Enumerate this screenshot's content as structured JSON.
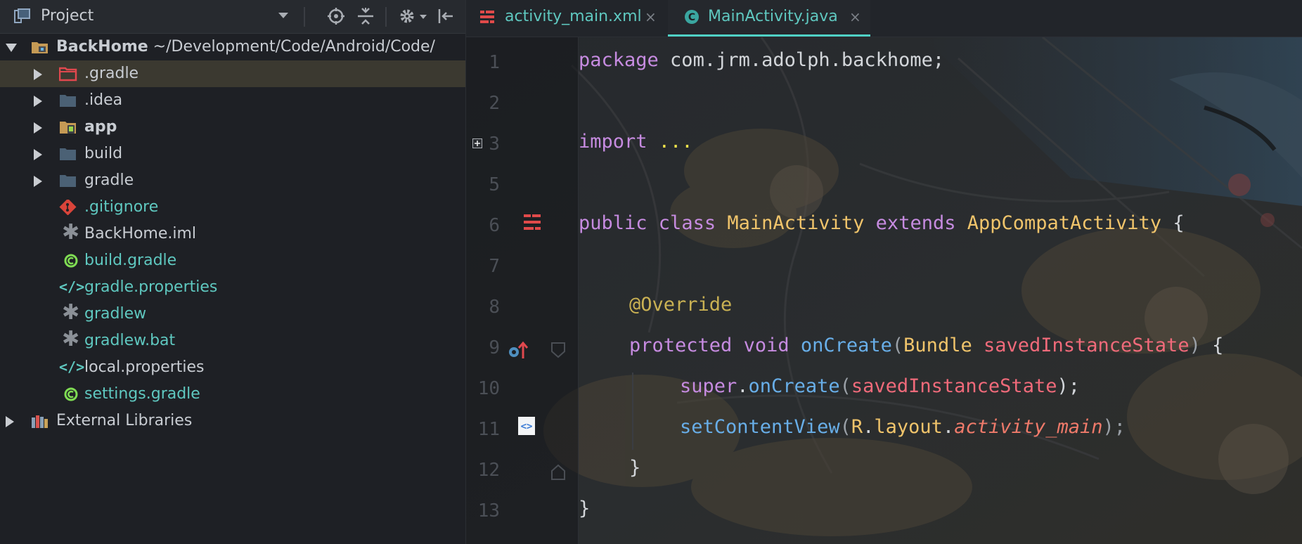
{
  "project_panel": {
    "title": "Project",
    "tree": [
      {
        "name": "BackHome",
        "path": " ~/Development/Code/Android/Code/",
        "level": 0,
        "expanded": true,
        "kind": "module-folder-icon"
      },
      {
        "name": ".gradle",
        "level": 1,
        "expandable": true,
        "kind": "excluded-folder-icon",
        "selected": true
      },
      {
        "name": ".idea",
        "level": 1,
        "expandable": true,
        "kind": "folder-icon"
      },
      {
        "name": "app",
        "level": 1,
        "expandable": true,
        "kind": "android-module-icon",
        "bold": true
      },
      {
        "name": "build",
        "level": 1,
        "expandable": true,
        "kind": "folder-icon"
      },
      {
        "name": "gradle",
        "level": 1,
        "expandable": true,
        "kind": "folder-icon"
      },
      {
        "name": ".gitignore",
        "level": 1,
        "kind": "git-icon",
        "teal": true
      },
      {
        "name": "BackHome.iml",
        "level": 1,
        "kind": "asterisk-icon"
      },
      {
        "name": "build.gradle",
        "level": 1,
        "kind": "gradle-icon",
        "teal": true
      },
      {
        "name": "gradle.properties",
        "level": 1,
        "kind": "properties-icon",
        "teal": true
      },
      {
        "name": "gradlew",
        "level": 1,
        "kind": "asterisk-icon",
        "teal": true
      },
      {
        "name": "gradlew.bat",
        "level": 1,
        "kind": "asterisk-icon",
        "teal": true
      },
      {
        "name": "local.properties",
        "level": 1,
        "kind": "properties-icon"
      },
      {
        "name": "settings.gradle",
        "level": 1,
        "kind": "gradle-icon",
        "teal": true
      },
      {
        "name": "External Libraries",
        "level": 0,
        "expandable": true,
        "kind": "libraries-icon"
      }
    ]
  },
  "editor": {
    "tabs": [
      {
        "label": "activity_main.xml",
        "close": "×",
        "icon": "layout-xml-icon",
        "active": false
      },
      {
        "label": "MainActivity.java",
        "close": "×",
        "icon": "java-class-icon",
        "active": true
      }
    ],
    "line_numbers": [
      "1",
      "2",
      "3",
      "5",
      "6",
      "7",
      "8",
      "9",
      "10",
      "11",
      "12",
      "13"
    ],
    "code": {
      "l1_kw": "package",
      "l1_rest": " com.jrm.adolph.backhome;",
      "l3_kw": "import",
      "l3_dots": " ...",
      "l6_kw1": "public",
      "l6_kw2": " class",
      "l6_cls": " MainActivity",
      "l6_kw3": " extends",
      "l6_cls2": " AppCompatActivity",
      "l6_brace": " {",
      "l8_ann": "@Override",
      "l9_kw1": "protected",
      "l9_kw2": " void",
      "l9_fn": " onCreate",
      "l9_p1": "(",
      "l9_cls": "Bundle",
      "l9_param": " savedInstanceState",
      "l9_p2": ")",
      "l9_brace": " {",
      "l10_kw": "super",
      "l10_dot": ".",
      "l10_fn": "onCreate",
      "l10_p1": "(",
      "l10_param": "savedInstanceState",
      "l10_p2": ");",
      "l11_fn": "setContentView",
      "l11_p1": "(",
      "l11_r": "R",
      "l11_dot1": ".",
      "l11_layout": "layout",
      "l11_dot2": ".",
      "l11_field": "activity_main",
      "l11_p2": ");",
      "l12": "}",
      "l13": "}"
    }
  },
  "colors": {
    "accent": "#4fd1c5",
    "keyword": "#c68be0",
    "class": "#f0c46b",
    "function": "#68aee8",
    "parameter": "#f06a7a"
  }
}
